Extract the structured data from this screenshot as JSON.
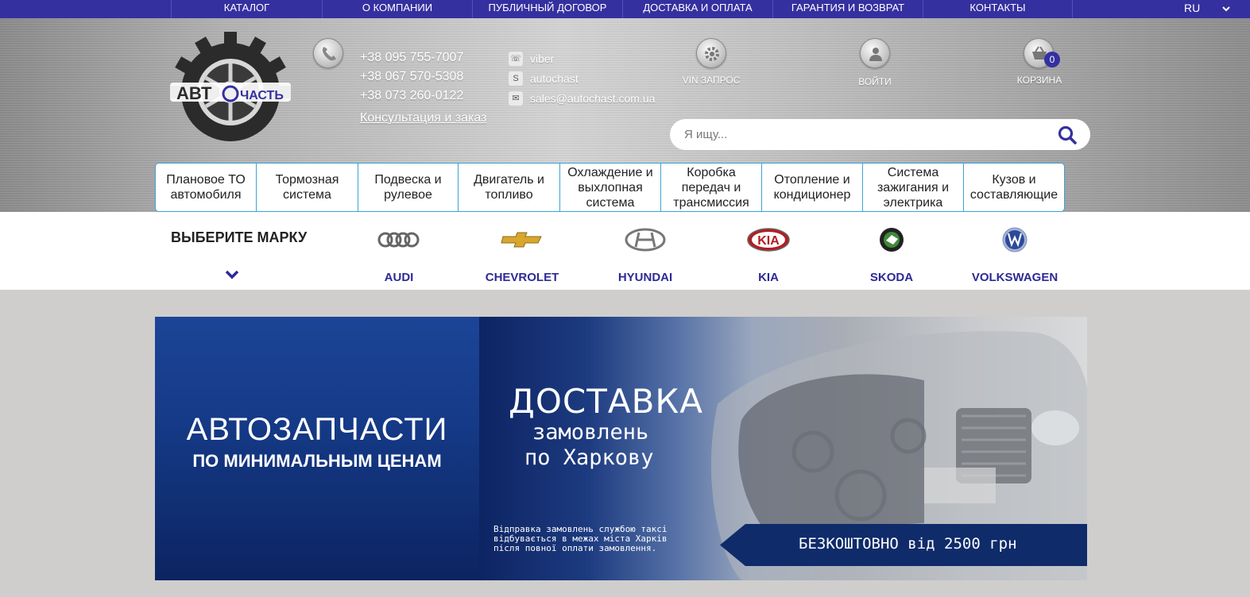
{
  "topnav": {
    "items": [
      "КАТАЛОГ",
      "О КОМПАНИИ",
      "ПУБЛИЧНЫЙ ДОГОВОР",
      "ДОСТАВКА И ОПЛАТА",
      "ГАРАНТИЯ И ВОЗВРАТ",
      "КОНТАКТЫ"
    ],
    "language": "RU"
  },
  "logo": {
    "text_left": "АВТ",
    "text_right": "ЧАСТЬ"
  },
  "phones": [
    "+38 095 755-7007",
    "+38 067 570-5308",
    "+38 073 260-0122"
  ],
  "consult_link": "Консультация и заказ",
  "contacts": {
    "viber": "viber",
    "skype": "autochast",
    "email": "sales@autochast.com.ua"
  },
  "actions": {
    "vin": "VIN ЗАПРОС",
    "login": "ВОЙТИ",
    "cart": "КОРЗИНА",
    "cart_count": "0"
  },
  "search": {
    "placeholder": "Я ищу..."
  },
  "categories": [
    "Плановое ТО автомобиля",
    "Тормозная система",
    "Подвеска и рулевое",
    "Двигатель и топливо",
    "Охлаждение и выхлопная система",
    "Коробка передач и трансмиссия",
    "Отопление и кондиционер",
    "Система зажигания и электрика",
    "Кузов и составляющие"
  ],
  "brands": {
    "title": "ВЫБЕРИТЕ МАРКУ",
    "items": [
      {
        "name": "AUDI",
        "icon": "audi-logo-icon"
      },
      {
        "name": "CHEVROLET",
        "icon": "chevrolet-logo-icon"
      },
      {
        "name": "HYUNDAI",
        "icon": "hyundai-logo-icon"
      },
      {
        "name": "KIA",
        "icon": "kia-logo-icon"
      },
      {
        "name": "SKODA",
        "icon": "skoda-logo-icon"
      },
      {
        "name": "VOLKSWAGEN",
        "icon": "volkswagen-logo-icon"
      }
    ]
  },
  "banner": {
    "left_title": "АВТОЗАПЧАСТИ",
    "left_subtitle": "ПО МИНИМАЛЬНЫМ ЦЕНАМ",
    "delivery_title": "ДОСТАВКА",
    "delivery_line1": "замовлень",
    "delivery_line2": "по Харкову",
    "delivery_note": "Відправка замовлень службою таксі відбувається в межах міста Харків після повної оплати замовлення.",
    "ribbon": "БЕЗКОШТОВНО від 2500 грн"
  },
  "colors": {
    "brand": "#3530a0",
    "category_border": "#3da3d6",
    "banner_blue": "#153a87"
  }
}
